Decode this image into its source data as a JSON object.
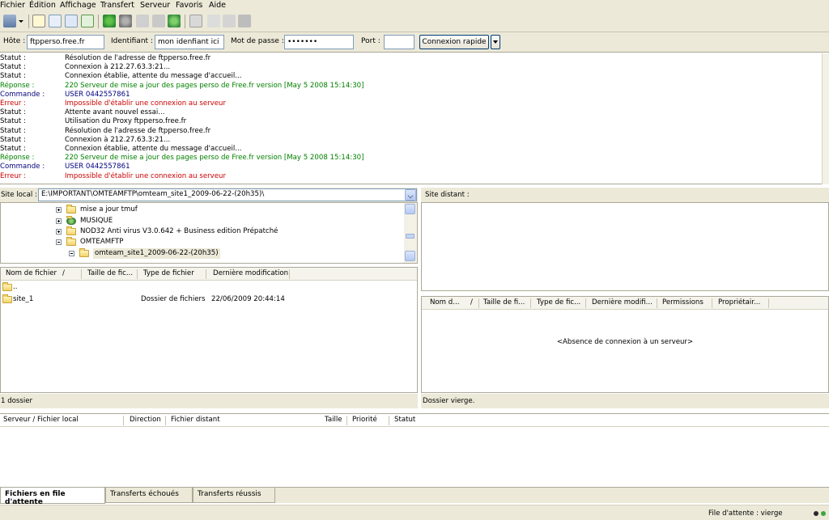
{
  "menu": [
    "Fichier",
    "Édition",
    "Affichage",
    "Transfert",
    "Serveur",
    "Favoris",
    "Aide"
  ],
  "quickconnect": {
    "host_label": "Hôte :",
    "host_value": "ftpperso.free.fr",
    "user_label": "Identifiant :",
    "user_value": "mon idenfiant ici",
    "pass_label": "Mot de passe :",
    "pass_value": "•••••••",
    "port_label": "Port :",
    "port_value": "",
    "connect_label": "Connexion rapide"
  },
  "log": [
    {
      "type": "Statut :",
      "msg": "Résolution de l'adresse de ftpperso.free.fr",
      "color": "#000000"
    },
    {
      "type": "Statut :",
      "msg": "Connexion à 212.27.63.3:21...",
      "color": "#000000"
    },
    {
      "type": "Statut :",
      "msg": "Connexion établie, attente du message d'accueil...",
      "color": "#000000"
    },
    {
      "type": "Réponse :",
      "msg": "220 Serveur de mise a jour des pages perso de Free.fr version [May  5 2008 15:14:30]",
      "color": "#008000"
    },
    {
      "type": "Commande :",
      "msg": "USER 0442557861",
      "color": "#000080"
    },
    {
      "type": "Erreur :",
      "msg": "Impossible d'établir une connexion au serveur",
      "color": "#cc0000"
    },
    {
      "type": "Statut :",
      "msg": "Attente avant nouvel essai...",
      "color": "#000000"
    },
    {
      "type": "Statut :",
      "msg": "Utilisation du Proxy ftpperso.free.fr",
      "color": "#000000"
    },
    {
      "type": "Statut :",
      "msg": "Résolution de l'adresse de ftpperso.free.fr",
      "color": "#000000"
    },
    {
      "type": "Statut :",
      "msg": "Connexion à 212.27.63.3:21...",
      "color": "#000000"
    },
    {
      "type": "Statut :",
      "msg": "Connexion établie, attente du message d'accueil...",
      "color": "#000000"
    },
    {
      "type": "Réponse :",
      "msg": "220 Serveur de mise a jour des pages perso de Free.fr version [May  5 2008 15:14:30]",
      "color": "#008000"
    },
    {
      "type": "Commande :",
      "msg": "USER 0442557861",
      "color": "#000080"
    },
    {
      "type": "Erreur :",
      "msg": "Impossible d'établir une connexion au serveur",
      "color": "#cc0000"
    }
  ],
  "local": {
    "site_label": "Site local :",
    "path": "E:\\IMPORTANT\\OMTEAMFTP\\omteam_site1_2009-06-22-(20h35)\\",
    "tree": [
      {
        "label": "mise a jour tmuf",
        "expander": "plus"
      },
      {
        "label": "MUSIQUE",
        "expander": "plus"
      },
      {
        "label": "NOD32 Anti virus V3.0.642 + Business edition Prépatché",
        "expander": "plus"
      },
      {
        "label": "OMTEAMFTP",
        "expander": "minus"
      },
      {
        "label": "omteam_site1_2009-06-22-(20h35)",
        "expander": "minus"
      }
    ],
    "columns": [
      "Nom de fichier",
      "/",
      "Taille de fic...",
      "Type de fichier",
      "Dernière modification"
    ],
    "files": [
      {
        "name": "..",
        "type": "",
        "modified": ""
      },
      {
        "name": "site_1",
        "type": "Dossier de fichiers",
        "modified": "22/06/2009 20:44:14"
      }
    ],
    "status": "1 dossier"
  },
  "remote": {
    "site_label": "Site distant :",
    "columns": [
      "Nom d...",
      "/",
      "Taille de fi...",
      "Type de fic...",
      "Dernière modifi...",
      "Permissions",
      "Propriétair..."
    ],
    "empty_message": "<Absence de connexion à un serveur>",
    "status": "Dossier vierge."
  },
  "queue": {
    "columns": [
      "Serveur / Fichier local",
      "Direction",
      "Fichier distant",
      "Taille",
      "Priorité",
      "Statut"
    ],
    "tabs": [
      "Fichiers en file d'attente",
      "Transferts échoués",
      "Transferts réussis"
    ]
  },
  "statusbar": {
    "text": "File d'attente : vierge"
  },
  "colors": {
    "chrome": "#ece9d8",
    "status_green": "#008000",
    "error_red": "#cc0000"
  }
}
